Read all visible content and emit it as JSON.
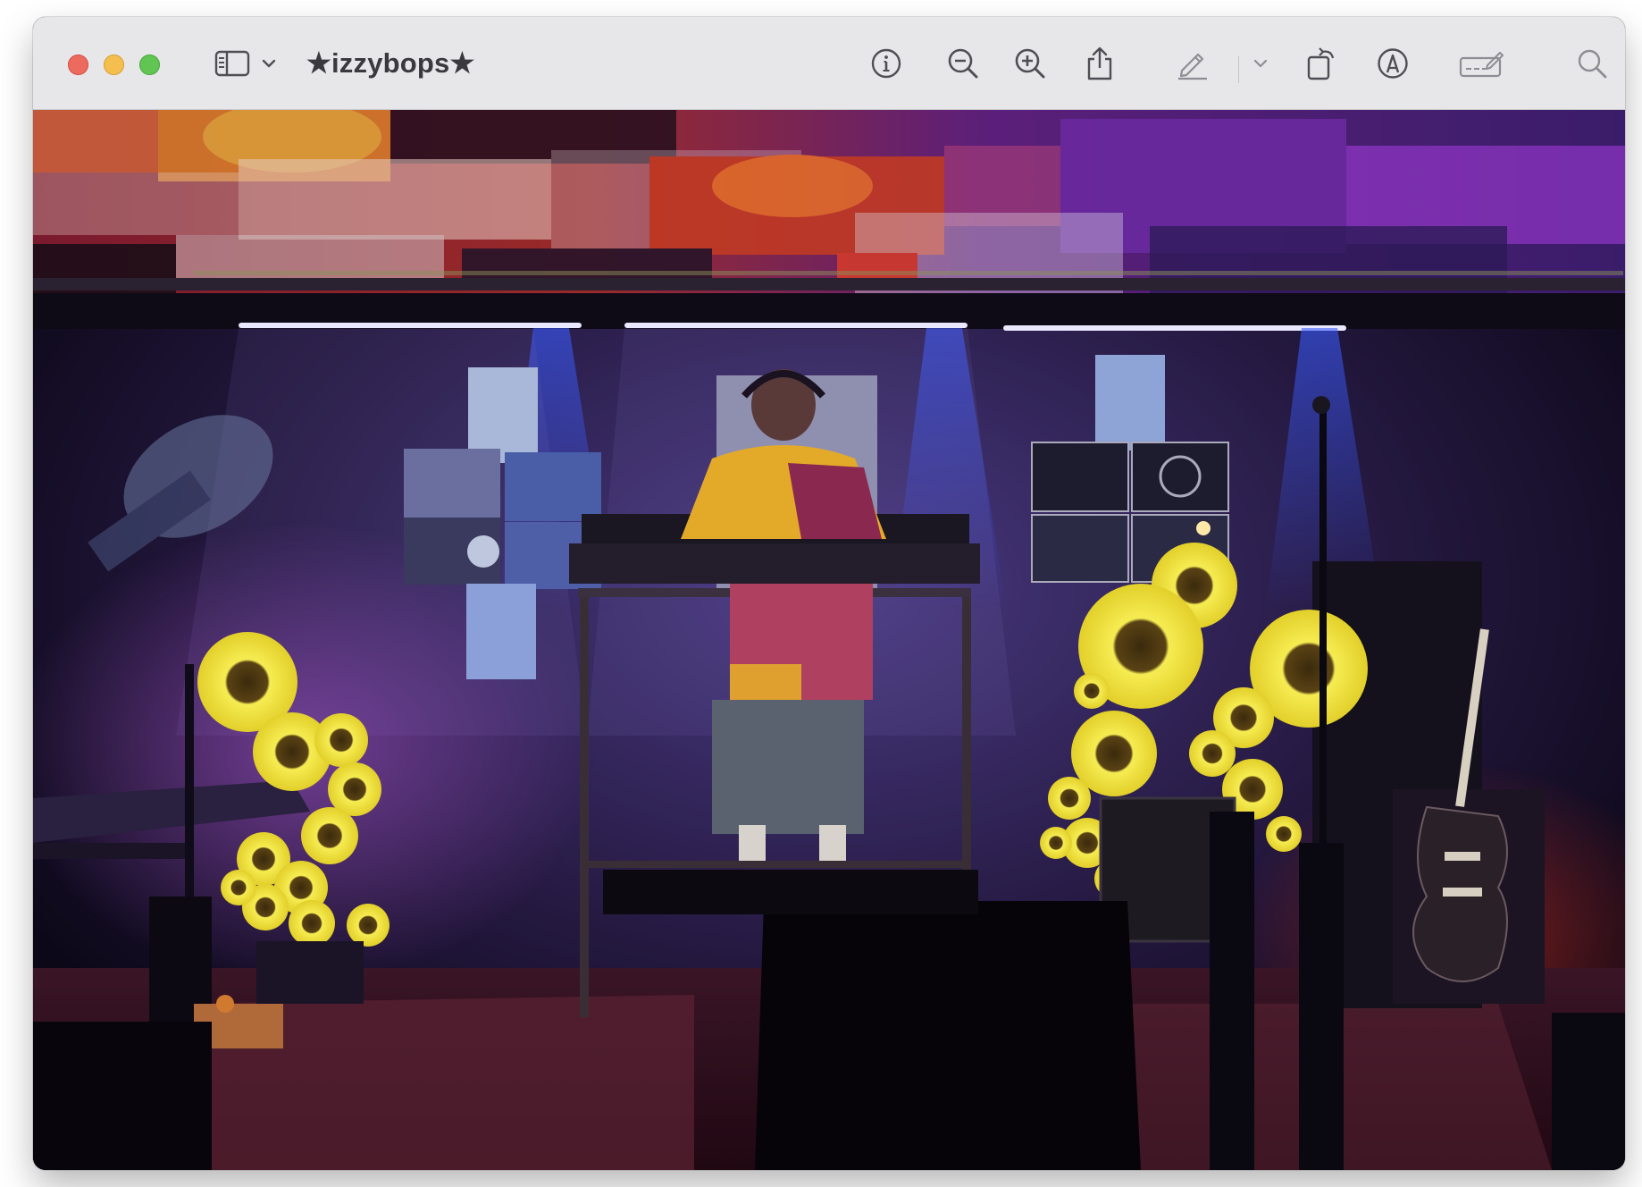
{
  "window": {
    "title": "★izzybops★"
  },
  "toolbar": {
    "buttons": [
      {
        "id": "sidebar-toggle",
        "icon": "sidebar-icon"
      },
      {
        "id": "sidebar-menu",
        "icon": "chevron-down-icon"
      },
      {
        "id": "info",
        "icon": "info-icon"
      },
      {
        "id": "zoom-out",
        "icon": "zoom-out-icon"
      },
      {
        "id": "zoom-in",
        "icon": "zoom-in-icon"
      },
      {
        "id": "share",
        "icon": "share-icon"
      },
      {
        "id": "markup",
        "icon": "pencil-icon"
      },
      {
        "id": "markup-menu",
        "icon": "chevron-down-icon"
      },
      {
        "id": "rotate",
        "icon": "rotate-icon"
      },
      {
        "id": "annotate",
        "icon": "markup-circle-icon"
      },
      {
        "id": "signature",
        "icon": "signature-icon"
      },
      {
        "id": "search",
        "icon": "search-icon"
      }
    ]
  },
  "photo": {
    "subject": "dj-performer-stage-with-sunflowers",
    "colors": {
      "ceiling_red": "#8a1f2a",
      "ceiling_purple": "#5b1f8a",
      "stage_haze": "#3a2a6e",
      "sunflower_yellow": "#f3e23a",
      "floor_red": "#4a1420"
    }
  }
}
